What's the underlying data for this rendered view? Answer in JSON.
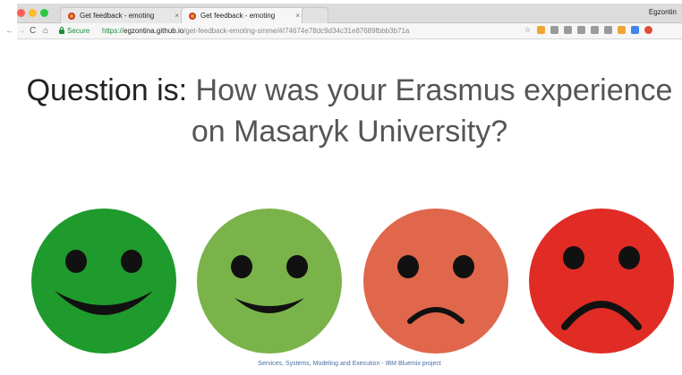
{
  "browser": {
    "tabs": [
      {
        "title": "Get feedback - emoting",
        "close": "×"
      },
      {
        "title": "Get feedback - emoting",
        "close": "×"
      }
    ],
    "profile_name": "Egzontin",
    "nav": {
      "back": "←",
      "forward": "→",
      "reload": "C",
      "home": "⌂"
    },
    "secure_label": "Secure",
    "url_scheme": "https://",
    "url_host": "egzontina.github.io",
    "url_path": "/get-feedback-emoting-smme/#/74674e78dc9d34c31e87689fbbb3b71a",
    "bookmark_star": "☆"
  },
  "question": {
    "label": "Question is:",
    "text": " How was your Erasmus experience on Masaryk University?"
  },
  "faces": [
    {
      "mood": "very-happy",
      "color": "#1f9a2c"
    },
    {
      "mood": "happy",
      "color": "#7ab34a"
    },
    {
      "mood": "sad",
      "color": "#e0674c"
    },
    {
      "mood": "very-sad",
      "color": "#e02c25"
    }
  ],
  "footer": "Services, Systems, Modeling and Execution - IBM Bluemix project",
  "colors": {
    "secure_green": "#1e8e3e",
    "footer_link": "#4a6fa5"
  }
}
